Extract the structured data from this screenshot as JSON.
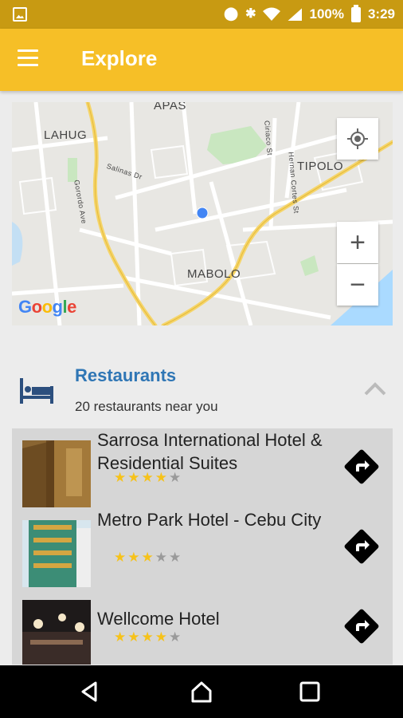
{
  "status_bar": {
    "battery_percent": "100%",
    "time": "3:29",
    "icons": [
      "image-icon",
      "location-icon",
      "bluetooth-icon",
      "wifi-icon",
      "signal-icon",
      "battery-icon"
    ]
  },
  "app_bar": {
    "title": "Explore",
    "menu_icon": "menu-icon",
    "background": "#f6bf27"
  },
  "map": {
    "labels": {
      "apas": "APAS",
      "lahug": "LAHUG",
      "tipolo": "TIPOLO",
      "mabolo": "MABOLO",
      "salinas": "Salinas Dr",
      "gorordo": "Gorordo Ave",
      "hernan": "Hernan Cortes St",
      "ciriaco": "Ciriaco St"
    },
    "zoom_in": "+",
    "zoom_out": "−",
    "google": [
      "G",
      "o",
      "o",
      "g",
      "l",
      "e"
    ]
  },
  "section": {
    "title": "Restaurants",
    "subtitle": "20 restaurants near you",
    "icon": "bed-icon",
    "title_color": "#2f76b5"
  },
  "places": [
    {
      "name": "Sarrosa International Hotel & Residential Suites",
      "rating": 4,
      "max": 5
    },
    {
      "name": "Metro Park Hotel - Cebu City",
      "rating": 3,
      "max": 5
    },
    {
      "name": "Wellcome Hotel",
      "rating": 4,
      "max": 5
    }
  ],
  "nav": {
    "back": "back-icon",
    "home": "home-icon",
    "recents": "recents-icon"
  }
}
